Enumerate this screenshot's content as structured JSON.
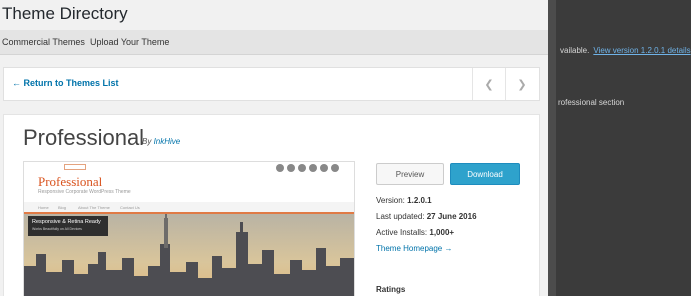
{
  "header": {
    "title": "Theme Directory"
  },
  "tabs": [
    "Commercial Themes",
    "Upload Your Theme"
  ],
  "nav": {
    "back_label": "← Return to Themes List",
    "prev_icon": "chevron-left-icon",
    "next_icon": "chevron-right-icon"
  },
  "theme": {
    "name": "Professional",
    "by_prefix": "By",
    "author": "InkHive",
    "preview_label": "Preview",
    "download_label": "Download",
    "version_label": "Version:",
    "version": "1.2.0.1",
    "updated_label": "Last updated:",
    "updated": "27 June 2016",
    "installs_label": "Active Installs:",
    "installs": "1,000+",
    "homepage_label": "Theme Homepage →",
    "ratings_label": "Ratings"
  },
  "screenshot": {
    "logo": "Professional",
    "tagline": "Responsive Corporate WordPress Theme",
    "menu": [
      "Home",
      "Blog",
      "About The Theme",
      "Contact Us"
    ],
    "banner_title": "Responsive & Retina Ready",
    "banner_sub": "Works Beautifully on All Devices"
  },
  "backdrop": {
    "notice_text": "vailable.",
    "notice_link": "View version 1.2.0.1 details",
    "section_text": "rofessional section"
  },
  "colors": {
    "accent": "#0073aa",
    "download": "#2ea2cc",
    "logo": "#d9531e",
    "overlay": "#3b3b3b"
  }
}
